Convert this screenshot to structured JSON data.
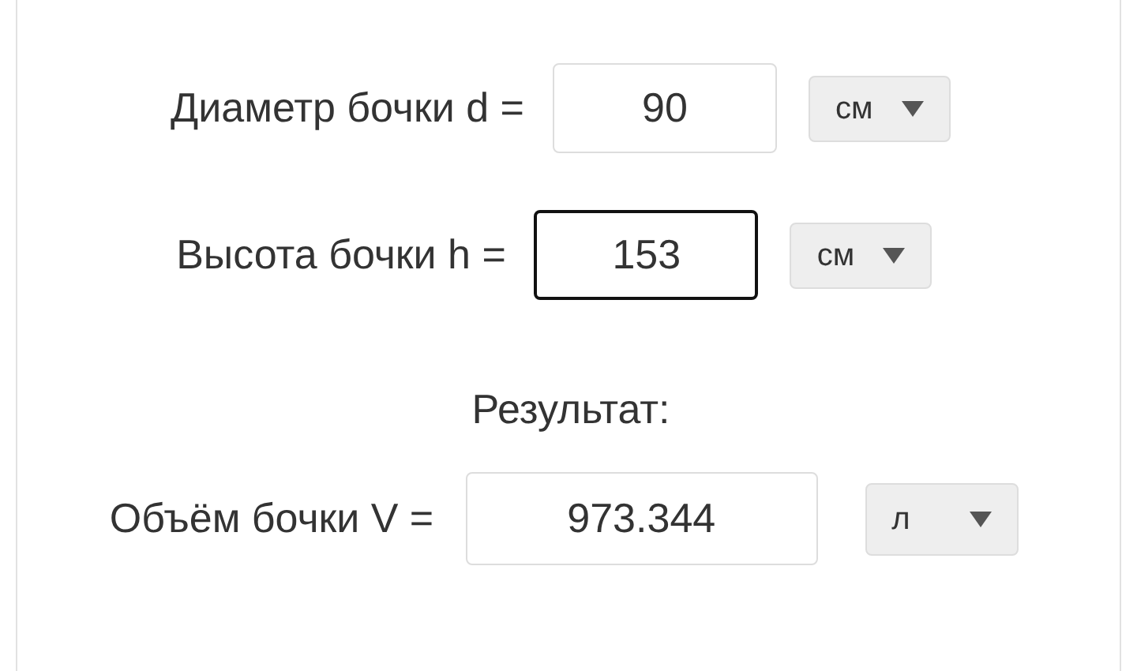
{
  "fields": [
    {
      "label": "Диаметр бочки d =",
      "value": "90",
      "unit": "см",
      "focused": false
    },
    {
      "label": "Высота бочки h =",
      "value": "153",
      "unit": "см",
      "focused": true
    }
  ],
  "result": {
    "heading": "Результат:",
    "label": "Объём бочки V =",
    "value": "973.344",
    "unit": "л"
  }
}
